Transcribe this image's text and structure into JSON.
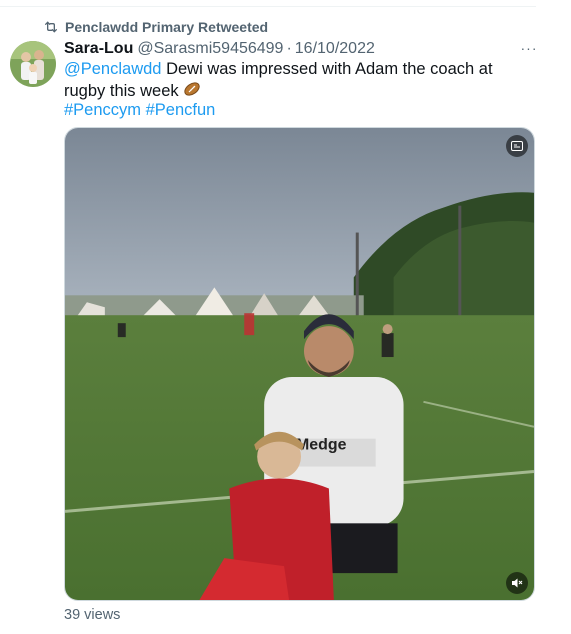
{
  "retweet": {
    "icon": "retweet-icon",
    "label": "Penclawdd Primary Retweeted"
  },
  "tweet": {
    "author_name": "Sara-Lou",
    "handle": "@Sarasmi59456499",
    "separator": "·",
    "date": "16/10/2022",
    "more_icon": "···",
    "mention": "@Penclawdd",
    "text": "Dewi was impressed with Adam the coach at rugby this week",
    "emoji": "rugby-ball-icon",
    "hashtags": [
      "#Penccym",
      "#Pencfun"
    ]
  },
  "media": {
    "type": "video",
    "top_right_icon": "caption-icon",
    "bottom_right_icon": "mute-icon",
    "shirt_text": "Medge"
  },
  "stats": {
    "views": "39 views"
  },
  "colors": {
    "link": "#1d9bf0",
    "secondary": "#536471",
    "text": "#0f1419"
  }
}
